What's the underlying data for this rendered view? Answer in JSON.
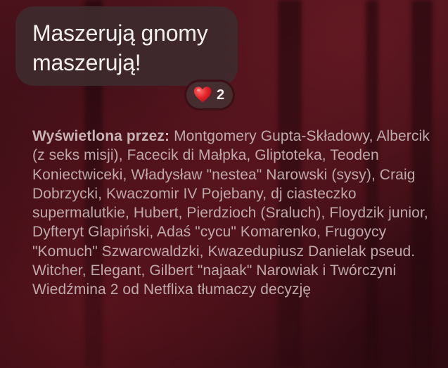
{
  "message": {
    "text": "Maszerują gnomy maszerują!"
  },
  "reaction": {
    "emoji": "heart-icon",
    "color": "#e3242b",
    "count": "2"
  },
  "seen_by": {
    "label": "Wyświetlona przez:",
    "names": "Montgomery Gupta-Składowy, Albercik (z seks misji), Facecik di Małpka, Gliptoteka, Teoden Koniectwiceki, Władysław \"nestea\" Narowski (sysy), Craig Dobrzycki, Kwaczomir IV Pojebany, dj ciasteczko supermalutkie, Hubert, Pierdzioch (Sraluch), Floydzik junior, Dyfteryt Glapiński, Adaś \"cycu\" Komarenko, Frugoycy \"Komuch\" Szwarcwaldzki, Kwazedupiusz Danielak pseud. Witcher, Elegant, Gilbert \"najaak\" Narowiak i Twórczyni Wiedźmina 2 od Netflixa tłumaczy decyzję"
  },
  "colors": {
    "bubble": "#3e2a2c",
    "background": "#3a0d14",
    "seen_text": "#bfa9ab"
  }
}
